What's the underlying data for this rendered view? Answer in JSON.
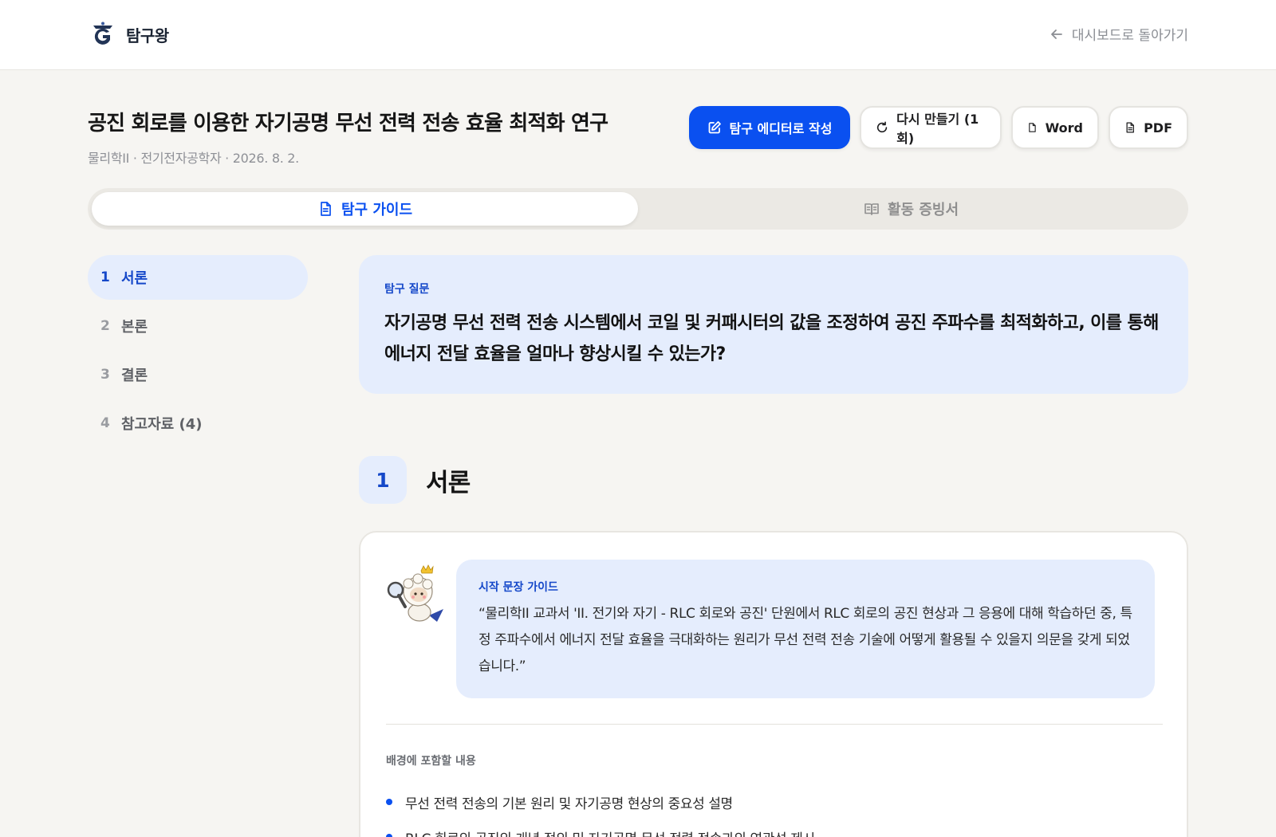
{
  "header": {
    "app_name": "탐구왕",
    "back_label": "대시보드로 돌아가기"
  },
  "page": {
    "title": "공진 회로를 이용한 자기공명 무선 전력 전송 효율 최적화 연구",
    "meta": "물리학II · 전기전자공학자 · 2026. 8. 2."
  },
  "actions": {
    "editor_label": "탐구 에디터로 작성",
    "regenerate_label": "다시 만들기 (1회)",
    "word_label": "Word",
    "pdf_label": "PDF"
  },
  "tabs": {
    "guide_label": "탐구 가이드",
    "certificate_label": "활동 증빙서"
  },
  "toc": [
    {
      "num": "1",
      "label": "서론"
    },
    {
      "num": "2",
      "label": "본론"
    },
    {
      "num": "3",
      "label": "결론"
    },
    {
      "num": "4",
      "label": "참고자료 (4)"
    }
  ],
  "question": {
    "label": "탐구 질문",
    "text": "자기공명 무선 전력 전송 시스템에서 코일 및 커패시터의 값을 조정하여 공진 주파수를 최적화하고, 이를 통해 에너지 전달 효율을 얼마나 향상시킬 수 있는가?"
  },
  "section": {
    "num": "1",
    "title": "서론"
  },
  "guide": {
    "label": "시작 문장 가이드",
    "text": "“물리학II 교과서 'II. 전기와 자기 - RLC 회로와 공진' 단원에서 RLC 회로의 공진 현상과 그 응용에 대해 학습하던 중, 특정 주파수에서 에너지 전달 효율을 극대화하는 원리가 무선 전력 전송 기술에 어떻게 활용될 수 있을지 의문을 갖게 되었습니다.”"
  },
  "background": {
    "label": "배경에 포함할 내용",
    "items": [
      "무선 전력 전송의 기본 원리 및 자기공명 현상의 중요성 설명",
      "RLC 회로의 공진의 개념 정의 및 자기공명 무선 전력 전송과의 연관성 제시"
    ]
  },
  "colors": {
    "primary": "#0a50f0",
    "accent_text": "#1548c9",
    "highlight_bg": "#e5edfd",
    "page_bg": "#f6f5f2"
  },
  "icons": {
    "logo": "logo-mark",
    "back": "arrow-left-icon",
    "editor": "edit-icon",
    "regenerate": "refresh-icon",
    "word": "file-icon",
    "pdf": "file-text-icon",
    "guide_tab": "document-icon",
    "certificate_tab": "book-icon"
  }
}
